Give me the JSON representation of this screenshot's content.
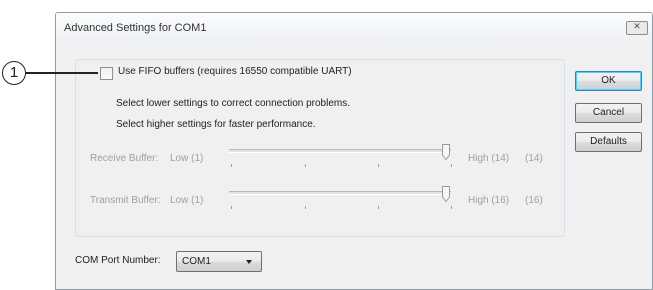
{
  "dialog": {
    "title": "Advanced Settings for COM1",
    "close_icon": "close-icon"
  },
  "fifo": {
    "label": "Use FIFO buffers (requires 16550 compatible UART)",
    "checked": false
  },
  "hints": {
    "lower": "Select lower settings to correct connection problems.",
    "higher": "Select higher settings for faster performance."
  },
  "receive": {
    "label": "Receive Buffer:",
    "low": "Low (1)",
    "high": "High (14)",
    "value": "(14)",
    "level": 1.0
  },
  "transmit": {
    "label": "Transmit Buffer:",
    "low": "Low (1)",
    "high": "High (16)",
    "value": "(16)",
    "level": 1.0
  },
  "buttons": {
    "ok": "OK",
    "cancel": "Cancel",
    "defaults": "Defaults"
  },
  "com_port": {
    "label": "COM Port Number:",
    "selected": "COM1"
  },
  "callout": {
    "number": "1"
  },
  "colors": {
    "disabled_text": "#a0a0a0",
    "default_button_border": "#3c7fb1"
  }
}
